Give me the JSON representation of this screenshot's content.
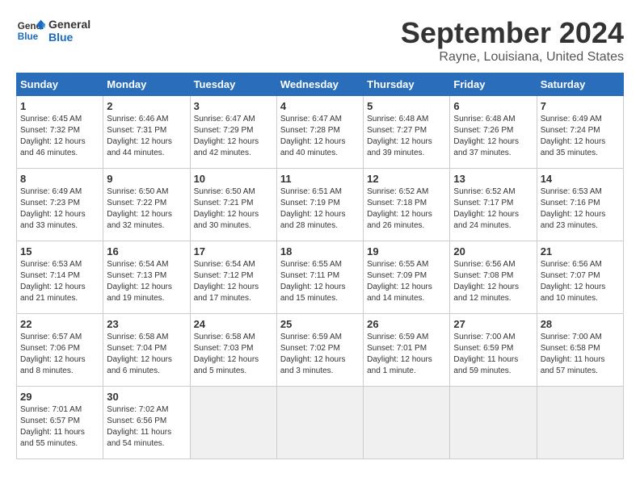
{
  "logo": {
    "line1": "General",
    "line2": "Blue"
  },
  "title": "September 2024",
  "subtitle": "Rayne, Louisiana, United States",
  "days_of_week": [
    "Sunday",
    "Monday",
    "Tuesday",
    "Wednesday",
    "Thursday",
    "Friday",
    "Saturday"
  ],
  "weeks": [
    [
      {
        "day": "1",
        "info": "Sunrise: 6:45 AM\nSunset: 7:32 PM\nDaylight: 12 hours\nand 46 minutes."
      },
      {
        "day": "2",
        "info": "Sunrise: 6:46 AM\nSunset: 7:31 PM\nDaylight: 12 hours\nand 44 minutes."
      },
      {
        "day": "3",
        "info": "Sunrise: 6:47 AM\nSunset: 7:29 PM\nDaylight: 12 hours\nand 42 minutes."
      },
      {
        "day": "4",
        "info": "Sunrise: 6:47 AM\nSunset: 7:28 PM\nDaylight: 12 hours\nand 40 minutes."
      },
      {
        "day": "5",
        "info": "Sunrise: 6:48 AM\nSunset: 7:27 PM\nDaylight: 12 hours\nand 39 minutes."
      },
      {
        "day": "6",
        "info": "Sunrise: 6:48 AM\nSunset: 7:26 PM\nDaylight: 12 hours\nand 37 minutes."
      },
      {
        "day": "7",
        "info": "Sunrise: 6:49 AM\nSunset: 7:24 PM\nDaylight: 12 hours\nand 35 minutes."
      }
    ],
    [
      {
        "day": "8",
        "info": "Sunrise: 6:49 AM\nSunset: 7:23 PM\nDaylight: 12 hours\nand 33 minutes."
      },
      {
        "day": "9",
        "info": "Sunrise: 6:50 AM\nSunset: 7:22 PM\nDaylight: 12 hours\nand 32 minutes."
      },
      {
        "day": "10",
        "info": "Sunrise: 6:50 AM\nSunset: 7:21 PM\nDaylight: 12 hours\nand 30 minutes."
      },
      {
        "day": "11",
        "info": "Sunrise: 6:51 AM\nSunset: 7:19 PM\nDaylight: 12 hours\nand 28 minutes."
      },
      {
        "day": "12",
        "info": "Sunrise: 6:52 AM\nSunset: 7:18 PM\nDaylight: 12 hours\nand 26 minutes."
      },
      {
        "day": "13",
        "info": "Sunrise: 6:52 AM\nSunset: 7:17 PM\nDaylight: 12 hours\nand 24 minutes."
      },
      {
        "day": "14",
        "info": "Sunrise: 6:53 AM\nSunset: 7:16 PM\nDaylight: 12 hours\nand 23 minutes."
      }
    ],
    [
      {
        "day": "15",
        "info": "Sunrise: 6:53 AM\nSunset: 7:14 PM\nDaylight: 12 hours\nand 21 minutes."
      },
      {
        "day": "16",
        "info": "Sunrise: 6:54 AM\nSunset: 7:13 PM\nDaylight: 12 hours\nand 19 minutes."
      },
      {
        "day": "17",
        "info": "Sunrise: 6:54 AM\nSunset: 7:12 PM\nDaylight: 12 hours\nand 17 minutes."
      },
      {
        "day": "18",
        "info": "Sunrise: 6:55 AM\nSunset: 7:11 PM\nDaylight: 12 hours\nand 15 minutes."
      },
      {
        "day": "19",
        "info": "Sunrise: 6:55 AM\nSunset: 7:09 PM\nDaylight: 12 hours\nand 14 minutes."
      },
      {
        "day": "20",
        "info": "Sunrise: 6:56 AM\nSunset: 7:08 PM\nDaylight: 12 hours\nand 12 minutes."
      },
      {
        "day": "21",
        "info": "Sunrise: 6:56 AM\nSunset: 7:07 PM\nDaylight: 12 hours\nand 10 minutes."
      }
    ],
    [
      {
        "day": "22",
        "info": "Sunrise: 6:57 AM\nSunset: 7:06 PM\nDaylight: 12 hours\nand 8 minutes."
      },
      {
        "day": "23",
        "info": "Sunrise: 6:58 AM\nSunset: 7:04 PM\nDaylight: 12 hours\nand 6 minutes."
      },
      {
        "day": "24",
        "info": "Sunrise: 6:58 AM\nSunset: 7:03 PM\nDaylight: 12 hours\nand 5 minutes."
      },
      {
        "day": "25",
        "info": "Sunrise: 6:59 AM\nSunset: 7:02 PM\nDaylight: 12 hours\nand 3 minutes."
      },
      {
        "day": "26",
        "info": "Sunrise: 6:59 AM\nSunset: 7:01 PM\nDaylight: 12 hours\nand 1 minute."
      },
      {
        "day": "27",
        "info": "Sunrise: 7:00 AM\nSunset: 6:59 PM\nDaylight: 11 hours\nand 59 minutes."
      },
      {
        "day": "28",
        "info": "Sunrise: 7:00 AM\nSunset: 6:58 PM\nDaylight: 11 hours\nand 57 minutes."
      }
    ],
    [
      {
        "day": "29",
        "info": "Sunrise: 7:01 AM\nSunset: 6:57 PM\nDaylight: 11 hours\nand 55 minutes."
      },
      {
        "day": "30",
        "info": "Sunrise: 7:02 AM\nSunset: 6:56 PM\nDaylight: 11 hours\nand 54 minutes."
      },
      {
        "day": "",
        "info": ""
      },
      {
        "day": "",
        "info": ""
      },
      {
        "day": "",
        "info": ""
      },
      {
        "day": "",
        "info": ""
      },
      {
        "day": "",
        "info": ""
      }
    ]
  ]
}
